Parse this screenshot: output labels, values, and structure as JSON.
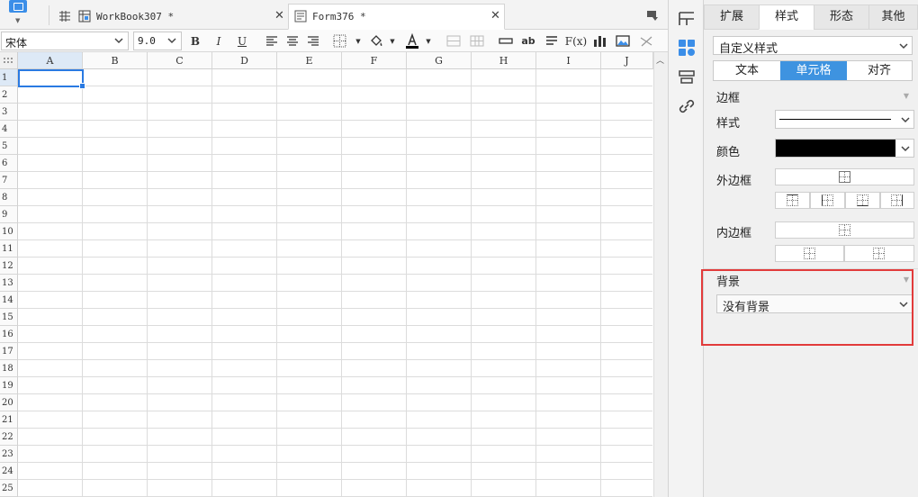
{
  "tabs": [
    {
      "label": "WorkBook307 *",
      "active": false,
      "icon": "workbook-icon"
    },
    {
      "label": "Form376 *",
      "active": true,
      "icon": "form-icon"
    }
  ],
  "toolbar": {
    "font_name": "宋体",
    "font_size": "9.0",
    "bold": "B",
    "italic": "I",
    "underline": "U",
    "text_color": "#000000",
    "fill_color": "#ffffff"
  },
  "sheet": {
    "columns": [
      "A",
      "B",
      "C",
      "D",
      "E",
      "F",
      "G",
      "H",
      "I",
      "J"
    ],
    "rows": [
      "1",
      "2",
      "3",
      "4",
      "5",
      "6",
      "7",
      "8",
      "9",
      "10",
      "11",
      "12",
      "13",
      "14",
      "15",
      "16",
      "17",
      "18",
      "19",
      "20",
      "21",
      "22",
      "23",
      "24",
      "25"
    ],
    "selected_cell": "A1"
  },
  "panel": {
    "tabs": [
      "扩展",
      "样式",
      "形态",
      "其他"
    ],
    "active_tab": "样式",
    "style_select": "自定义样式",
    "subtabs": [
      "文本",
      "单元格",
      "对齐"
    ],
    "active_subtab": "单元格",
    "border_section": "边框",
    "style_label": "样式",
    "color_label": "颜色",
    "border_color": "#000000",
    "outer_border_label": "外边框",
    "inner_border_label": "内边框",
    "background_section": "背景",
    "background_select": "没有背景"
  },
  "colors": {
    "accent": "#3e93e0",
    "highlight": "#e23b3b"
  }
}
